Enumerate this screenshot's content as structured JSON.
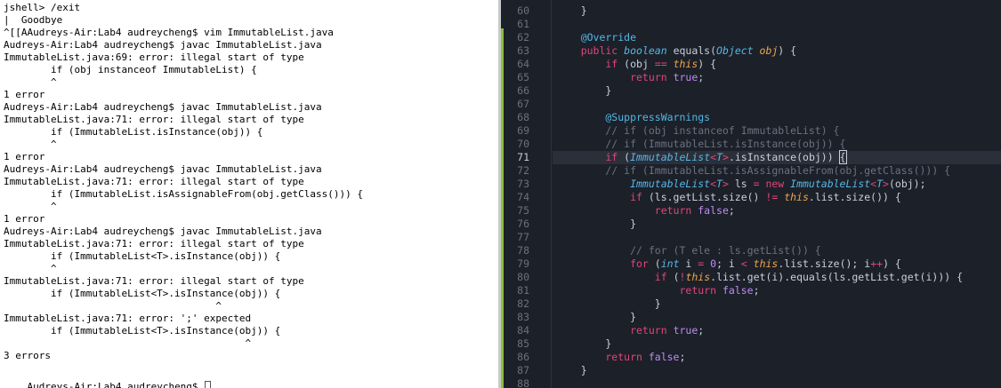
{
  "terminal": {
    "lines": [
      "jshell> /exit",
      "|  Goodbye",
      "^[[AAudreys-Air:Lab4 audreycheng$ vim ImmutableList.java",
      "Audreys-Air:Lab4 audreycheng$ javac ImmutableList.java",
      "ImmutableList.java:69: error: illegal start of type",
      "        if (obj instanceof ImmutableList) {",
      "        ^",
      "1 error",
      "Audreys-Air:Lab4 audreycheng$ javac ImmutableList.java",
      "ImmutableList.java:71: error: illegal start of type",
      "        if (ImmutableList.isInstance(obj)) {",
      "        ^",
      "1 error",
      "Audreys-Air:Lab4 audreycheng$ javac ImmutableList.java",
      "ImmutableList.java:71: error: illegal start of type",
      "        if (ImmutableList.isAssignableFrom(obj.getClass())) {",
      "        ^",
      "1 error",
      "Audreys-Air:Lab4 audreycheng$ javac ImmutableList.java",
      "ImmutableList.java:71: error: illegal start of type",
      "        if (ImmutableList<T>.isInstance(obj)) {",
      "        ^",
      "ImmutableList.java:71: error: illegal start of type",
      "        if (ImmutableList<T>.isInstance(obj)) {",
      "                                    ^",
      "ImmutableList.java:71: error: ';' expected",
      "        if (ImmutableList<T>.isInstance(obj)) {",
      "                                         ^",
      "3 errors"
    ],
    "prompt": "Audreys-Air:Lab4 audreycheng$ "
  },
  "editor": {
    "current_line": "71",
    "line_numbers": [
      "60",
      "61",
      "62",
      "63",
      "64",
      "65",
      "66",
      "67",
      "68",
      "69",
      "70",
      "71",
      "72",
      "73",
      "74",
      "75",
      "76",
      "77",
      "78",
      "79",
      "80",
      "81",
      "82",
      "83",
      "84",
      "85",
      "86",
      "87",
      "88"
    ],
    "code": [
      [
        {
          "t": "    }",
          "c": "plain"
        }
      ],
      [],
      [
        {
          "t": "    @Override",
          "c": "ann"
        }
      ],
      [
        {
          "t": "    public ",
          "c": "kw"
        },
        {
          "t": "boolean ",
          "c": "type"
        },
        {
          "t": "equals",
          "c": "plain"
        },
        {
          "t": "(",
          "c": "plain"
        },
        {
          "t": "Object ",
          "c": "type"
        },
        {
          "t": "obj",
          "c": "param"
        },
        {
          "t": ") {",
          "c": "plain"
        }
      ],
      [
        {
          "t": "        if ",
          "c": "kw"
        },
        {
          "t": "(obj ",
          "c": "plain"
        },
        {
          "t": "== ",
          "c": "kw"
        },
        {
          "t": "this",
          "c": "self"
        },
        {
          "t": ") {",
          "c": "plain"
        }
      ],
      [
        {
          "t": "            return ",
          "c": "kw"
        },
        {
          "t": "true",
          "c": "lit"
        },
        {
          "t": ";",
          "c": "plain"
        }
      ],
      [
        {
          "t": "        }",
          "c": "plain"
        }
      ],
      [],
      [
        {
          "t": "        @SuppressWarnings",
          "c": "ann"
        }
      ],
      [
        {
          "t": "        // if (obj instanceof ImmutableList) {",
          "c": "cmt"
        }
      ],
      [
        {
          "t": "        // if (ImmutableList.isInstance(obj)) {",
          "c": "cmt"
        }
      ],
      [
        {
          "t": "        if ",
          "c": "kw"
        },
        {
          "t": "(",
          "c": "plain"
        },
        {
          "t": "ImmutableList",
          "c": "type"
        },
        {
          "t": "<",
          "c": "kw"
        },
        {
          "t": "T",
          "c": "type"
        },
        {
          "t": ">",
          "c": "kw"
        },
        {
          "t": ".isInstance(obj)) ",
          "c": "plain"
        },
        {
          "t": "{",
          "c": "plain"
        }
      ],
      [
        {
          "t": "        // if (ImmutableList.isAssignableFrom(obj.getClass())) {",
          "c": "cmt"
        }
      ],
      [
        {
          "t": "            ImmutableList",
          "c": "type"
        },
        {
          "t": "<",
          "c": "kw"
        },
        {
          "t": "T",
          "c": "type"
        },
        {
          "t": "> ",
          "c": "kw"
        },
        {
          "t": "ls ",
          "c": "plain"
        },
        {
          "t": "= new ",
          "c": "kw"
        },
        {
          "t": "ImmutableList",
          "c": "type"
        },
        {
          "t": "<",
          "c": "kw"
        },
        {
          "t": "T",
          "c": "type"
        },
        {
          "t": ">",
          "c": "kw"
        },
        {
          "t": "(obj);",
          "c": "plain"
        }
      ],
      [
        {
          "t": "            if ",
          "c": "kw"
        },
        {
          "t": "(ls.getList.size() ",
          "c": "plain"
        },
        {
          "t": "!= ",
          "c": "kw"
        },
        {
          "t": "this",
          "c": "self"
        },
        {
          "t": ".list.size()) {",
          "c": "plain"
        }
      ],
      [
        {
          "t": "                return ",
          "c": "kw"
        },
        {
          "t": "false",
          "c": "lit"
        },
        {
          "t": ";",
          "c": "plain"
        }
      ],
      [
        {
          "t": "            }",
          "c": "plain"
        }
      ],
      [],
      [
        {
          "t": "            // for (T ele : ls.getList()) {",
          "c": "cmt"
        }
      ],
      [
        {
          "t": "            for ",
          "c": "kw"
        },
        {
          "t": "(",
          "c": "plain"
        },
        {
          "t": "int ",
          "c": "type"
        },
        {
          "t": "i ",
          "c": "plain"
        },
        {
          "t": "= ",
          "c": "kw"
        },
        {
          "t": "0",
          "c": "lit"
        },
        {
          "t": "; i ",
          "c": "plain"
        },
        {
          "t": "< ",
          "c": "kw"
        },
        {
          "t": "this",
          "c": "self"
        },
        {
          "t": ".list.size(); i",
          "c": "plain"
        },
        {
          "t": "++",
          "c": "kw"
        },
        {
          "t": ") {",
          "c": "plain"
        }
      ],
      [
        {
          "t": "                if ",
          "c": "kw"
        },
        {
          "t": "(",
          "c": "plain"
        },
        {
          "t": "!",
          "c": "kw"
        },
        {
          "t": "this",
          "c": "self"
        },
        {
          "t": ".list.get(i).equals(ls.getList.get(i))) {",
          "c": "plain"
        }
      ],
      [
        {
          "t": "                    return ",
          "c": "kw"
        },
        {
          "t": "false",
          "c": "lit"
        },
        {
          "t": ";",
          "c": "plain"
        }
      ],
      [
        {
          "t": "                }",
          "c": "plain"
        }
      ],
      [
        {
          "t": "            }",
          "c": "plain"
        }
      ],
      [
        {
          "t": "            return ",
          "c": "kw"
        },
        {
          "t": "true",
          "c": "lit"
        },
        {
          "t": ";",
          "c": "plain"
        }
      ],
      [
        {
          "t": "        }",
          "c": "plain"
        }
      ],
      [
        {
          "t": "        return ",
          "c": "kw"
        },
        {
          "t": "false",
          "c": "lit"
        },
        {
          "t": ";",
          "c": "plain"
        }
      ],
      [
        {
          "t": "    }",
          "c": "plain"
        }
      ],
      []
    ]
  },
  "colors": {
    "editor_bg": "#1c2029",
    "keyword": "#e0457b",
    "type": "#55b7e6",
    "literal": "#bd8cf2",
    "this": "#f0a44b",
    "comment": "#6a7180",
    "changed_lines_marker": "#8bbf3a"
  }
}
